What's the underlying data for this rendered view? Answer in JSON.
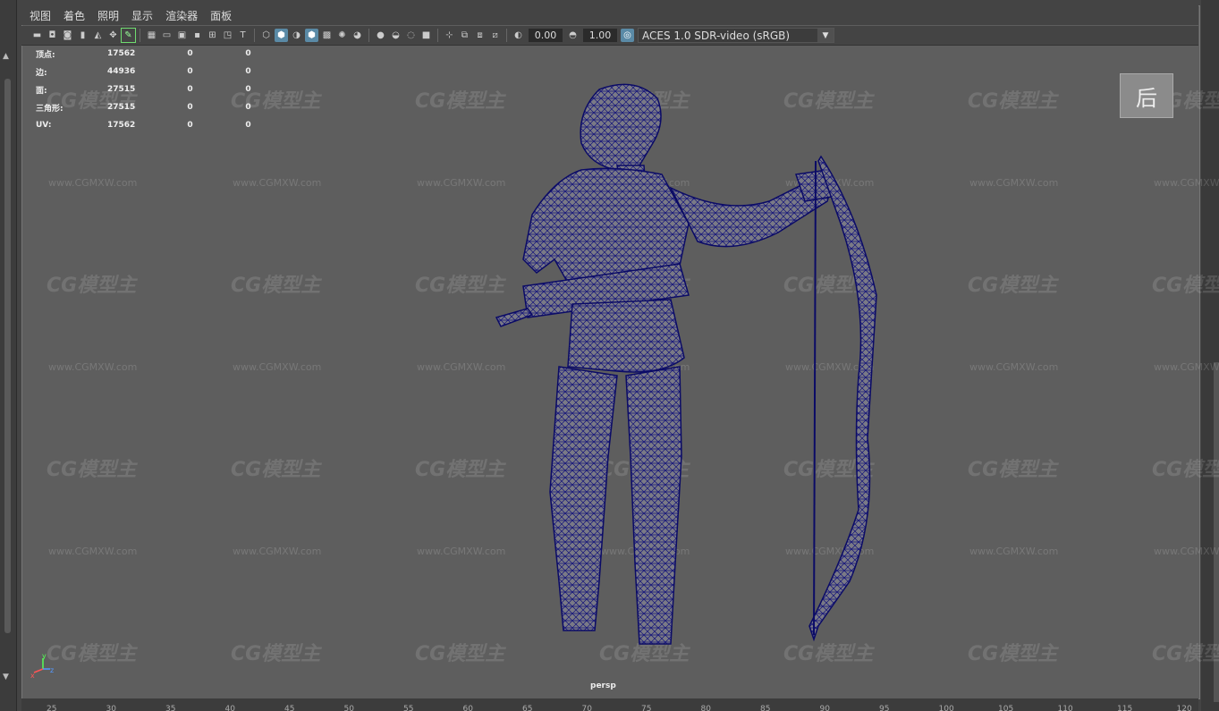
{
  "menu": [
    "视图",
    "着色",
    "照明",
    "显示",
    "渲染器",
    "面板"
  ],
  "toolbar": {
    "field_a": "0.00",
    "field_b": "1.00",
    "colorspace": "ACES 1.0 SDR-video (sRGB)"
  },
  "hud": [
    {
      "label": "顶点:",
      "v1": "17562",
      "v2": "0",
      "v3": "0"
    },
    {
      "label": "边:",
      "v1": "44936",
      "v2": "0",
      "v3": "0"
    },
    {
      "label": "面:",
      "v1": "27515",
      "v2": "0",
      "v3": "0"
    },
    {
      "label": "三角形:",
      "v1": "27515",
      "v2": "0",
      "v3": "0"
    },
    {
      "label": "UV:",
      "v1": "17562",
      "v2": "0",
      "v3": "0"
    }
  ],
  "watermark": {
    "logo": "CG模型主",
    "url": "www.CGMXW.com"
  },
  "corner_badge": "后",
  "camera_label": "persp",
  "ruler_ticks": [
    "25",
    "30",
    "35",
    "40",
    "45",
    "50",
    "55",
    "60",
    "65",
    "70",
    "75",
    "80",
    "85",
    "90",
    "95",
    "100",
    "105",
    "110",
    "115",
    "120"
  ],
  "axis": {
    "x": "x",
    "y": "y",
    "z": "z"
  },
  "icons": [
    "camera-icon",
    "select-icon",
    "lasso-icon",
    "paint-icon",
    "grid-icon",
    "film-gate-icon",
    "resolution-gate-icon",
    "wireframe-icon",
    "smooth-shade-icon",
    "textured-icon",
    "lights-icon",
    "shadow-icon",
    "xray-icon",
    "isolate-icon",
    "exposure-icon",
    "gamma-icon",
    "colorspace-icon"
  ]
}
